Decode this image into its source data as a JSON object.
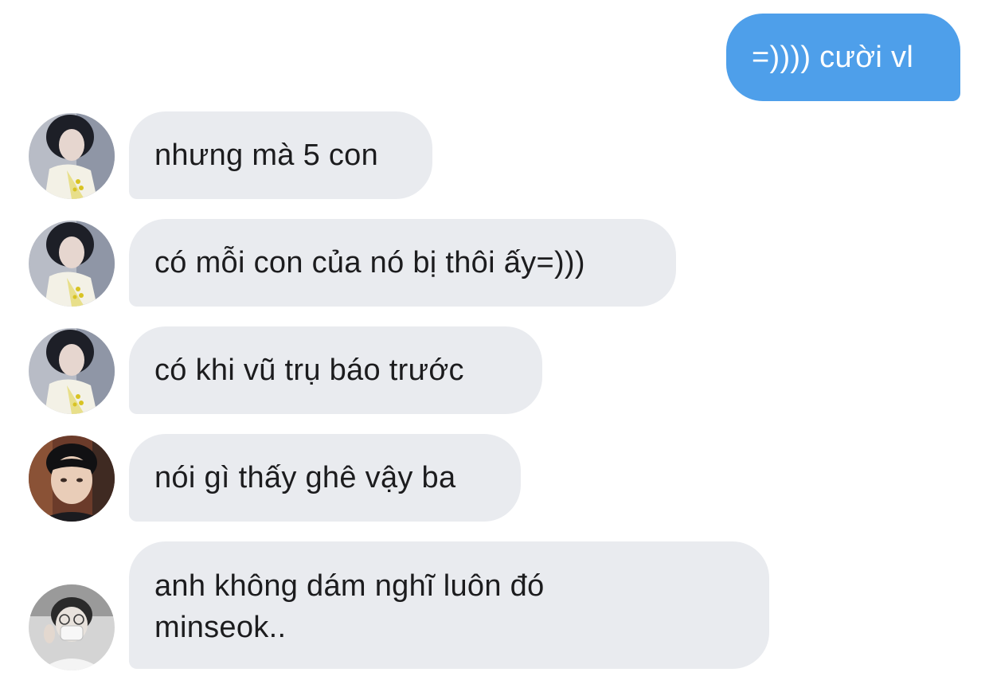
{
  "conversation": {
    "messages": [
      {
        "direction": "outgoing",
        "text": "=)))) cười vl"
      },
      {
        "direction": "incoming",
        "avatar": "person-avatar-1",
        "text": "nhưng mà 5 con"
      },
      {
        "direction": "incoming",
        "avatar": "person-avatar-1",
        "text": "có mỗi con của nó bị thôi ấy=)))"
      },
      {
        "direction": "incoming",
        "avatar": "person-avatar-1",
        "text": "có khi vũ trụ báo trước"
      },
      {
        "direction": "incoming",
        "avatar": "person-avatar-2",
        "text": "nói gì thấy ghê vậy ba"
      },
      {
        "direction": "incoming",
        "avatar": "person-avatar-3",
        "lines": [
          "anh không dám nghĩ luôn đó",
          "minseok.."
        ]
      }
    ]
  },
  "colors": {
    "outgoing_bubble": "#4e9fea",
    "incoming_bubble": "#e9ebef",
    "text_dark": "#1c1c1e",
    "text_light": "#ffffff"
  }
}
